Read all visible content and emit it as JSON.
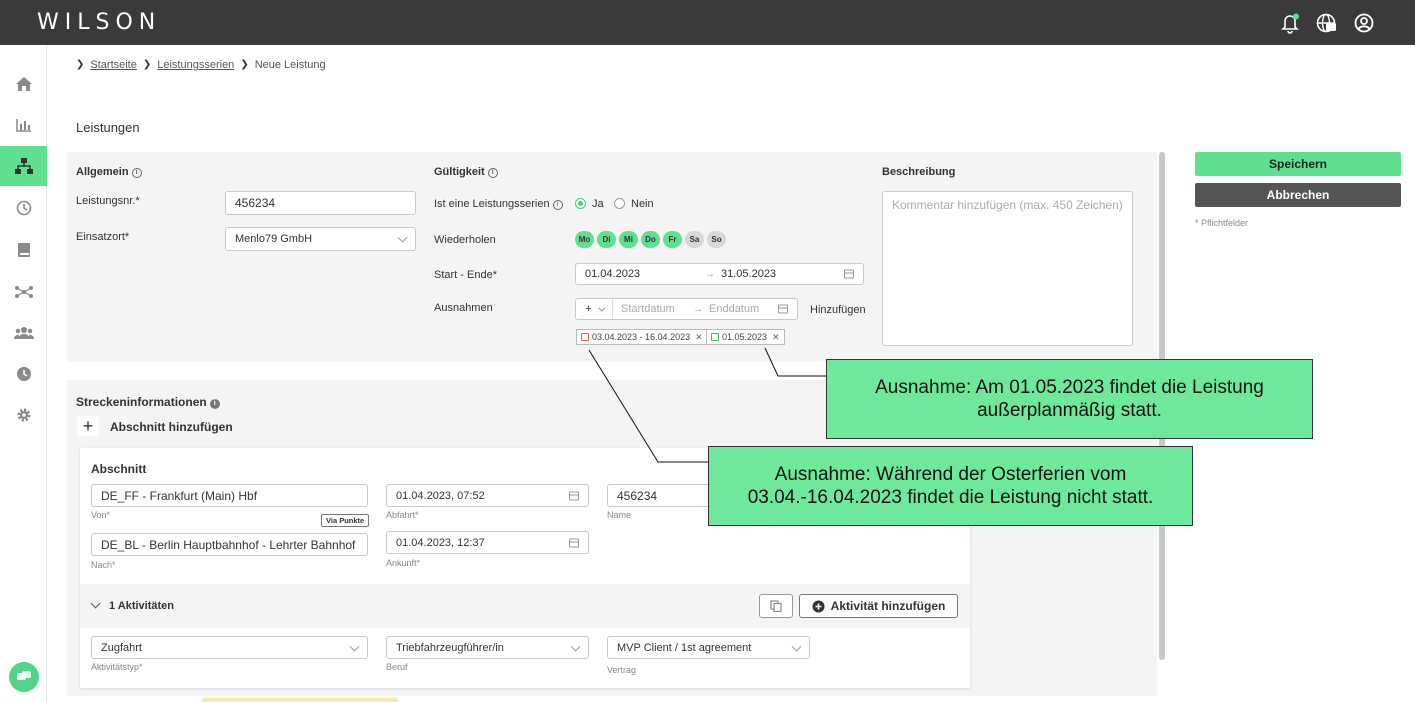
{
  "app": {
    "logo": "WILSON"
  },
  "breadcrumb": {
    "items": [
      "Startseite",
      "Leistungsserien",
      "Neue Leistung"
    ]
  },
  "page": {
    "title": "Leistungen"
  },
  "allgemein": {
    "title": "Allgemein",
    "leistungsnr_label": "Leistungsnr.*",
    "leistungsnr_value": "456234",
    "einsatzort_label": "Einsatzort*",
    "einsatzort_value": "Menlo79 GmbH"
  },
  "gueltigkeit": {
    "title": "Gültigkeit",
    "serie_label": "Ist eine Leistungsserien",
    "ja": "Ja",
    "nein": "Nein",
    "wiederholen_label": "Wiederholen",
    "days": [
      {
        "label": "Mo",
        "active": true
      },
      {
        "label": "Di",
        "active": true
      },
      {
        "label": "Mi",
        "active": true
      },
      {
        "label": "Do",
        "active": true
      },
      {
        "label": "Fr",
        "active": true
      },
      {
        "label": "Sa",
        "active": false
      },
      {
        "label": "So",
        "active": false
      }
    ],
    "start_ende_label": "Start - Ende*",
    "start": "01.04.2023",
    "ende": "31.05.2023",
    "ausnahmen_label": "Ausnahmen",
    "ausnahmen_type": "+",
    "startdatum_placeholder": "Startdatum",
    "enddatum_placeholder": "Enddatum",
    "hinzufuegen": "Hinzufügen",
    "tag_exclude": "03.04.2023 - 16.04.2023",
    "tag_include": "01.05.2023",
    "tag_exclude_color": "#e05a5a",
    "tag_include_color": "#3fb86c"
  },
  "beschreibung": {
    "title": "Beschreibung",
    "placeholder": "Kommentar hinzufügen (max. 450 Zeichen)"
  },
  "actions": {
    "save": "Speichern",
    "cancel": "Abbrechen",
    "required_note": "* Pflichtfelder"
  },
  "strecke": {
    "title": "Streckeninformationen",
    "add_section": "Abschnitt hinzufügen",
    "section_title": "Abschnitt",
    "von_value": "DE_FF - Frankfurt (Main) Hbf",
    "von_label": "Von*",
    "via_punkte": "Via Punkte",
    "abfahrt_value": "01.04.2023, 07:52",
    "abfahrt_label": "Abfahrt*",
    "name_value": "456234",
    "name_label": "Name",
    "nach_value": "DE_BL - Berlin Hauptbahnhof - Lehrter Bahnhof",
    "nach_label": "Nach*",
    "ankunft_value": "01.04.2023, 12:37",
    "ankunft_label": "Ankunft*",
    "activities_header": "1 Aktivitäten",
    "add_activity": "Aktivität hinzufügen",
    "aktivitaetstyp_value": "Zugfahrt",
    "aktivitaetstyp_label": "Aktivitätstyp*",
    "beruf_value": "Triebfahrzeugführer/in",
    "beruf_label": "Beruf",
    "vertrag_value": "MVP Client / 1st agreement",
    "vertrag_label": "Vertrag"
  },
  "callouts": {
    "include": "Ausnahme: Am 01.05.2023 findet die Leistung außerplanmäßig statt.",
    "exclude": "Ausnahme: Während der Osterferien vom 03.04.-16.04.2023 findet die Leistung nicht statt."
  },
  "icons": {
    "bell": "bell-icon",
    "globe": "globe-chat-icon",
    "user": "user-circle-icon"
  }
}
